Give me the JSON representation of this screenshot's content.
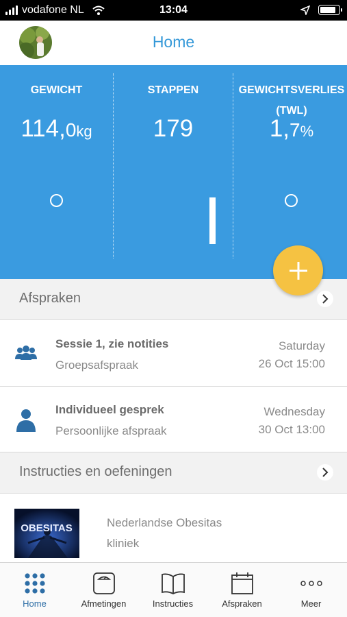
{
  "status_bar": {
    "carrier": "vodafone NL",
    "time": "13:04",
    "battery_level": 0.85
  },
  "header": {
    "title": "Home",
    "avatar": "profile-photo"
  },
  "stats": {
    "weight": {
      "label": "GEWICHT",
      "value_main": "114,",
      "value_decimal": "0",
      "unit": "kg"
    },
    "steps": {
      "label": "STAPPEN",
      "value": "179",
      "progress_fraction": 0.6
    },
    "weight_loss": {
      "label_line1": "GEWICHTSVERLIES",
      "label_line2": "(TWL)",
      "value_main": "1,",
      "value_decimal": "7",
      "unit": "%"
    },
    "add_button": "plus-icon",
    "colors": {
      "panel": "#3a9be0",
      "fab": "#f5c242"
    }
  },
  "appointments": {
    "section_title": "Afspraken",
    "items": [
      {
        "title": "Sessie 1, zie notities",
        "subtitle": "Groepsafspraak",
        "day": "Saturday",
        "date": "26 Oct 15:00",
        "icon": "group-icon"
      },
      {
        "title": "Individueel gesprek",
        "subtitle": "Persoonlijke afspraak",
        "day": "Wednesday",
        "date": "30 Oct 13:00",
        "icon": "person-icon"
      }
    ]
  },
  "instructions": {
    "section_title": "Instructies en oefeningen",
    "items": [
      {
        "title_line1": "Nederlandse Obesitas",
        "title_line2": "kliniek",
        "thumbnail_text": "OBESITAS"
      }
    ]
  },
  "tab_bar": {
    "active": "Home",
    "tabs": [
      {
        "label": "Home",
        "icon": "grid-icon"
      },
      {
        "label": "Afmetingen",
        "icon": "scale-icon"
      },
      {
        "label": "Instructies",
        "icon": "book-icon"
      },
      {
        "label": "Afspraken",
        "icon": "calendar-icon"
      },
      {
        "label": "Meer",
        "icon": "more-icon"
      }
    ]
  }
}
